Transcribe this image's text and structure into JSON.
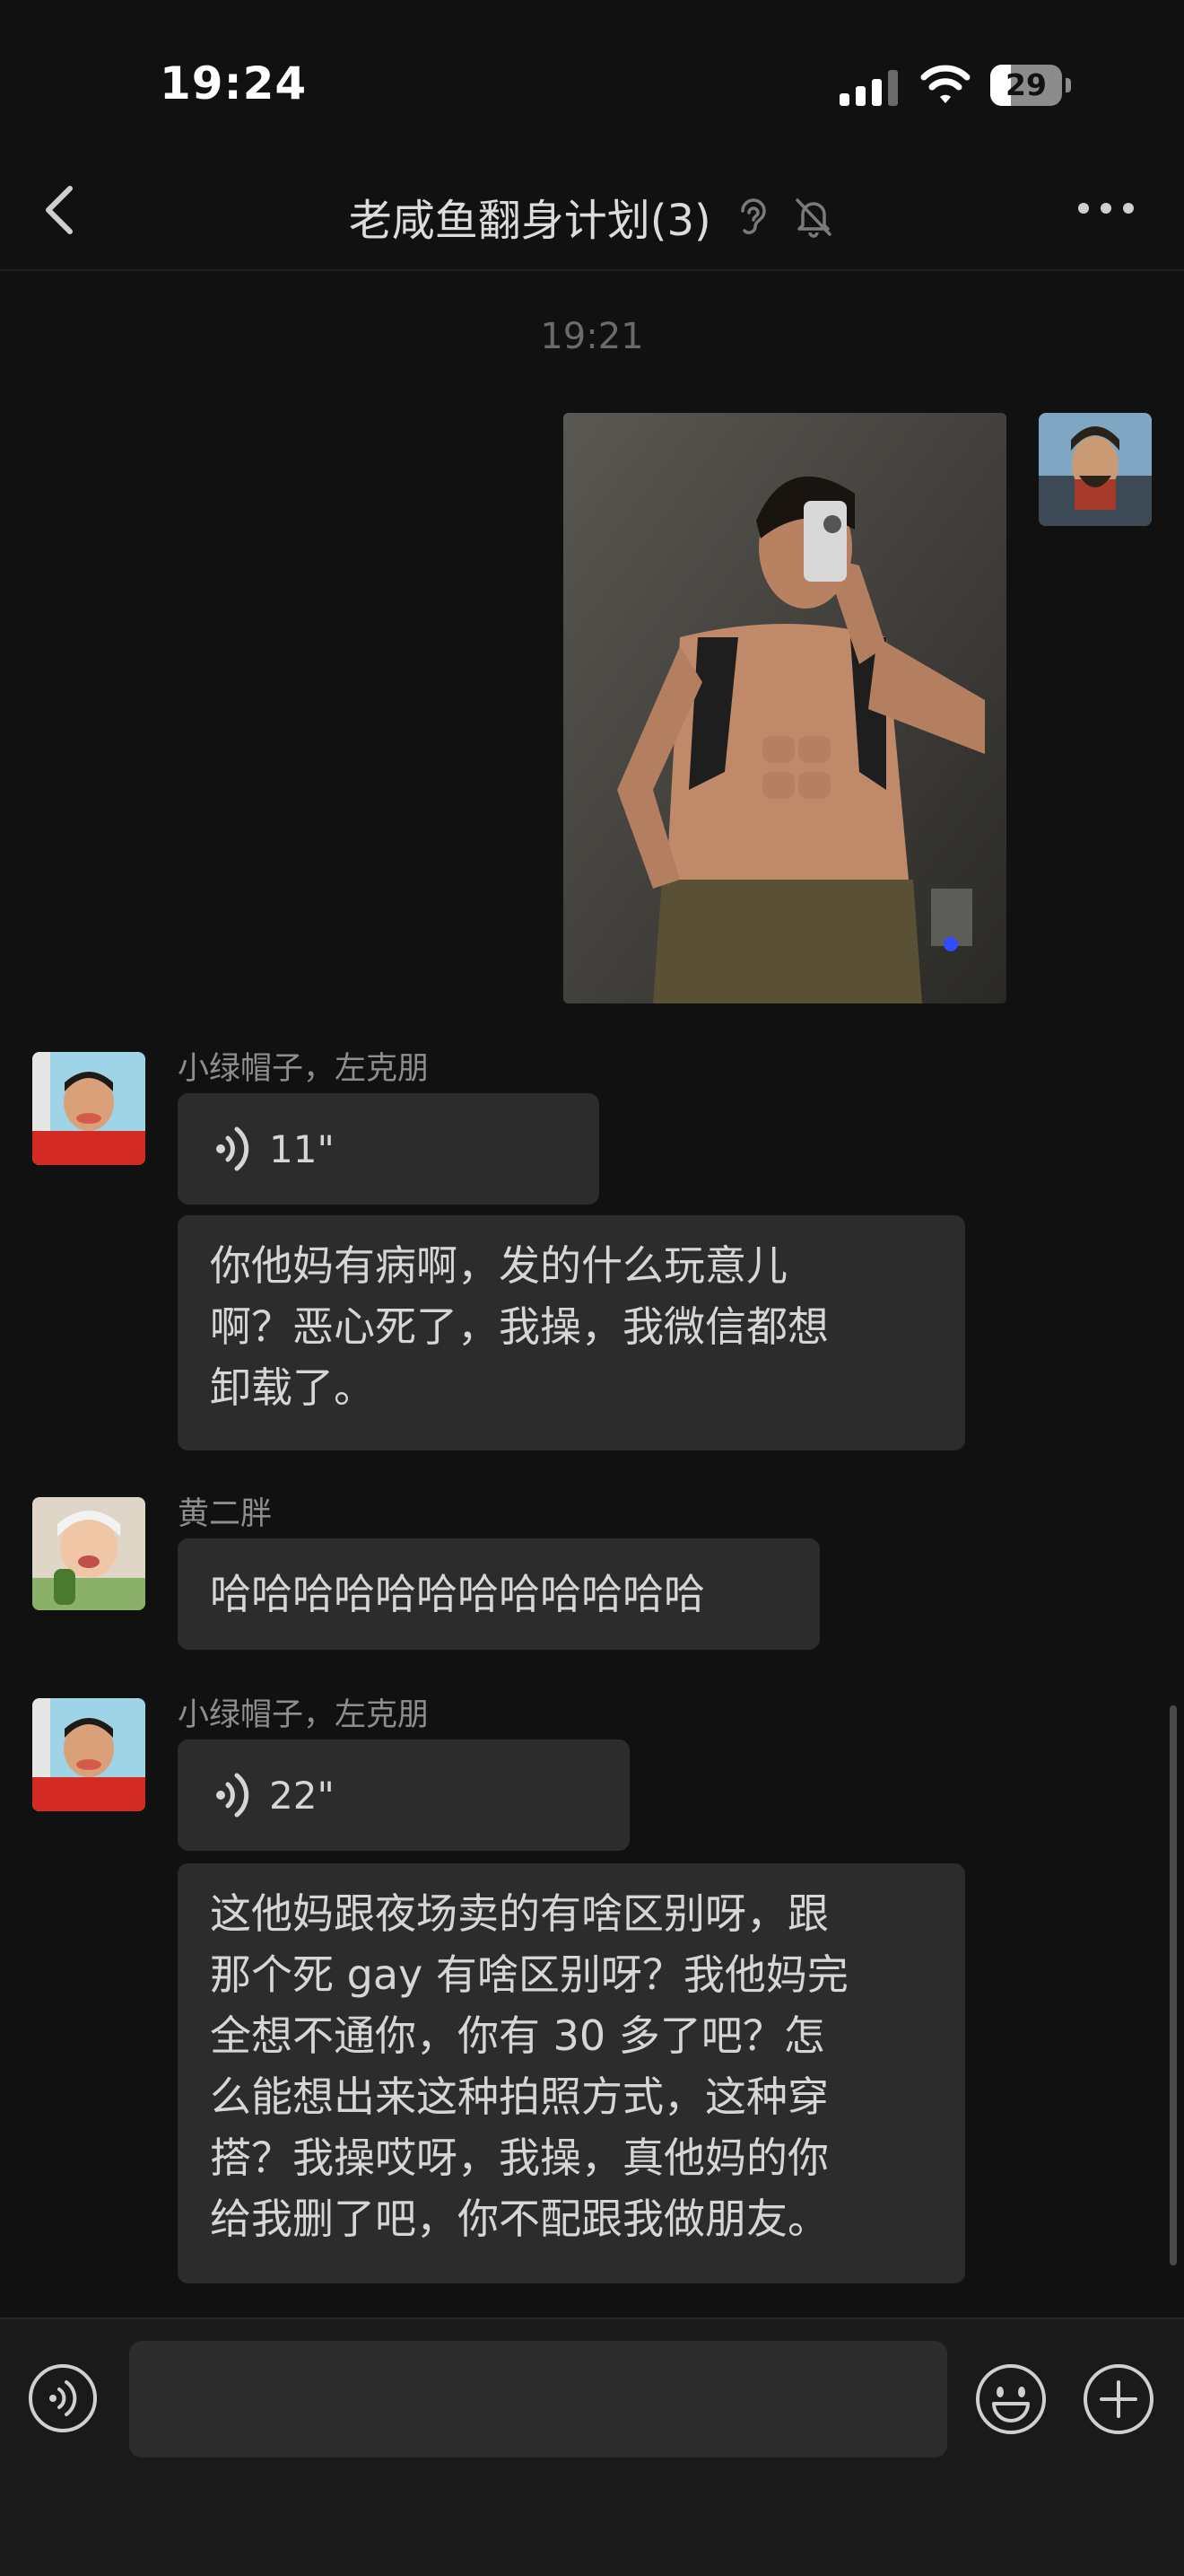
{
  "status_bar": {
    "time": "19:24",
    "battery": "29",
    "battery_level": 0.29
  },
  "nav": {
    "title": "老咸鱼翻身计划(3)"
  },
  "chat": {
    "timestamp": "19:21",
    "messages": [
      {
        "type": "image",
        "from": "me",
        "description_icon": "selfie-photo"
      },
      {
        "type": "voice",
        "sender": "小绿帽子，左克朋",
        "duration": "11\""
      },
      {
        "type": "text",
        "sender": "小绿帽子，左克朋",
        "lines": [
          "你他妈有病啊，发的什么玩意儿",
          "啊？恶心死了，我操，我微信都想",
          "卸载了。"
        ]
      },
      {
        "type": "text",
        "sender": "黄二胖",
        "lines": [
          "哈哈哈哈哈哈哈哈哈哈哈哈"
        ]
      },
      {
        "type": "voice",
        "sender": "小绿帽子，左克朋",
        "duration": "22\""
      },
      {
        "type": "text",
        "sender": "小绿帽子，左克朋",
        "lines": [
          "这他妈跟夜场卖的有啥区别呀，跟",
          "那个死 gay 有啥区别呀？我他妈完",
          "全想不通你，你有 30 多了吧？怎",
          "么能想出来这种拍照方式，这种穿",
          "搭？我操哎呀，我操，真他妈的你",
          "给我删了吧，你不配跟我做朋友。"
        ]
      }
    ]
  },
  "input": {
    "placeholder": ""
  },
  "colors": {
    "background": "#111111",
    "bubble": "#2c2c2c",
    "text": "#d6d6d6"
  }
}
